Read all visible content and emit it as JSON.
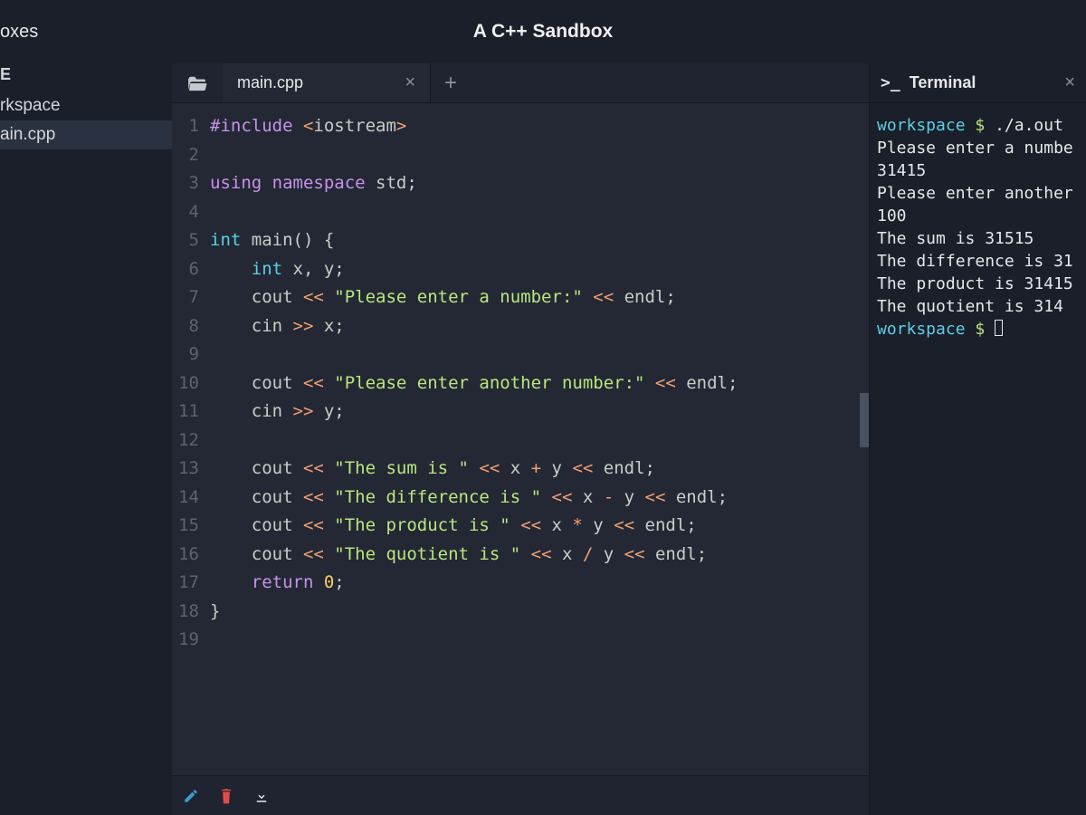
{
  "titlebar": {
    "left_truncated": "oxes",
    "title": "A C++ Sandbox"
  },
  "sidebar": {
    "header_truncated": "E",
    "items": [
      {
        "label_truncated": "rkspace"
      },
      {
        "label_truncated": "ain.cpp"
      }
    ]
  },
  "tabs": {
    "active": {
      "label": "main.cpp"
    }
  },
  "editor": {
    "lines": [
      {
        "n": 1,
        "tokens": [
          [
            "kw",
            "#include "
          ],
          [
            "op",
            "<"
          ],
          [
            "id",
            "iostream"
          ],
          [
            "op",
            ">"
          ]
        ]
      },
      {
        "n": 2,
        "tokens": []
      },
      {
        "n": 3,
        "tokens": [
          [
            "kw",
            "using "
          ],
          [
            "ns",
            "namespace "
          ],
          [
            "id",
            "std"
          ],
          [
            "id",
            ";"
          ]
        ]
      },
      {
        "n": 4,
        "tokens": []
      },
      {
        "n": 5,
        "tokens": [
          [
            "type",
            "int "
          ],
          [
            "fn",
            "main"
          ],
          [
            "id",
            "() {"
          ]
        ]
      },
      {
        "n": 6,
        "tokens": [
          [
            "id",
            "    "
          ],
          [
            "type",
            "int "
          ],
          [
            "id",
            "x, y;"
          ]
        ]
      },
      {
        "n": 7,
        "tokens": [
          [
            "id",
            "    cout "
          ],
          [
            "op",
            "<< "
          ],
          [
            "str",
            "\"Please enter a number:\" "
          ],
          [
            "op",
            "<< "
          ],
          [
            "id",
            "endl;"
          ]
        ]
      },
      {
        "n": 8,
        "tokens": [
          [
            "id",
            "    cin "
          ],
          [
            "op",
            ">> "
          ],
          [
            "id",
            "x;"
          ]
        ]
      },
      {
        "n": 9,
        "tokens": []
      },
      {
        "n": 10,
        "tokens": [
          [
            "id",
            "    cout "
          ],
          [
            "op",
            "<< "
          ],
          [
            "str",
            "\"Please enter another number:\" "
          ],
          [
            "op",
            "<< "
          ],
          [
            "id",
            "endl;"
          ]
        ]
      },
      {
        "n": 11,
        "tokens": [
          [
            "id",
            "    cin "
          ],
          [
            "op",
            ">> "
          ],
          [
            "id",
            "y;"
          ]
        ]
      },
      {
        "n": 12,
        "tokens": []
      },
      {
        "n": 13,
        "tokens": [
          [
            "id",
            "    cout "
          ],
          [
            "op",
            "<< "
          ],
          [
            "str",
            "\"The sum is \" "
          ],
          [
            "op",
            "<< "
          ],
          [
            "id",
            "x "
          ],
          [
            "op",
            "+ "
          ],
          [
            "id",
            "y "
          ],
          [
            "op",
            "<< "
          ],
          [
            "id",
            "endl;"
          ]
        ]
      },
      {
        "n": 14,
        "tokens": [
          [
            "id",
            "    cout "
          ],
          [
            "op",
            "<< "
          ],
          [
            "str",
            "\"The difference is \" "
          ],
          [
            "op",
            "<< "
          ],
          [
            "id",
            "x "
          ],
          [
            "op",
            "- "
          ],
          [
            "id",
            "y "
          ],
          [
            "op",
            "<< "
          ],
          [
            "id",
            "endl;"
          ]
        ]
      },
      {
        "n": 15,
        "tokens": [
          [
            "id",
            "    cout "
          ],
          [
            "op",
            "<< "
          ],
          [
            "str",
            "\"The product is \" "
          ],
          [
            "op",
            "<< "
          ],
          [
            "id",
            "x "
          ],
          [
            "op",
            "* "
          ],
          [
            "id",
            "y "
          ],
          [
            "op",
            "<< "
          ],
          [
            "id",
            "endl;"
          ]
        ]
      },
      {
        "n": 16,
        "tokens": [
          [
            "id",
            "    cout "
          ],
          [
            "op",
            "<< "
          ],
          [
            "str",
            "\"The quotient is \" "
          ],
          [
            "op",
            "<< "
          ],
          [
            "id",
            "x "
          ],
          [
            "op",
            "/ "
          ],
          [
            "id",
            "y "
          ],
          [
            "op",
            "<< "
          ],
          [
            "id",
            "endl;"
          ]
        ]
      },
      {
        "n": 17,
        "tokens": [
          [
            "id",
            "    "
          ],
          [
            "kw",
            "return "
          ],
          [
            "num",
            "0"
          ],
          [
            "id",
            ";"
          ]
        ]
      },
      {
        "n": 18,
        "tokens": [
          [
            "id",
            "}"
          ]
        ]
      },
      {
        "n": 19,
        "tokens": []
      }
    ]
  },
  "terminal": {
    "title": "Terminal",
    "lines": [
      [
        [
          "prompt-path",
          "workspace "
        ],
        [
          "prompt-dollar",
          "$ "
        ],
        [
          "",
          "./a.out"
        ]
      ],
      [
        [
          "",
          "Please enter a numbe"
        ]
      ],
      [
        [
          "",
          "31415"
        ]
      ],
      [
        [
          "",
          "Please enter another"
        ]
      ],
      [
        [
          "",
          "100"
        ]
      ],
      [
        [
          "",
          "The sum is 31515"
        ]
      ],
      [
        [
          "",
          "The difference is 31"
        ]
      ],
      [
        [
          "",
          "The product is 31415"
        ]
      ],
      [
        [
          "",
          "The quotient is 314"
        ]
      ],
      [
        [
          "prompt-path",
          "workspace "
        ],
        [
          "prompt-dollar",
          "$ "
        ]
      ]
    ]
  },
  "icons": {
    "folder": "folder-open-icon",
    "close": "×",
    "plus": "+",
    "edit": "pencil-icon",
    "trash": "trash-icon",
    "download": "download-icon",
    "prompt": ">_"
  }
}
